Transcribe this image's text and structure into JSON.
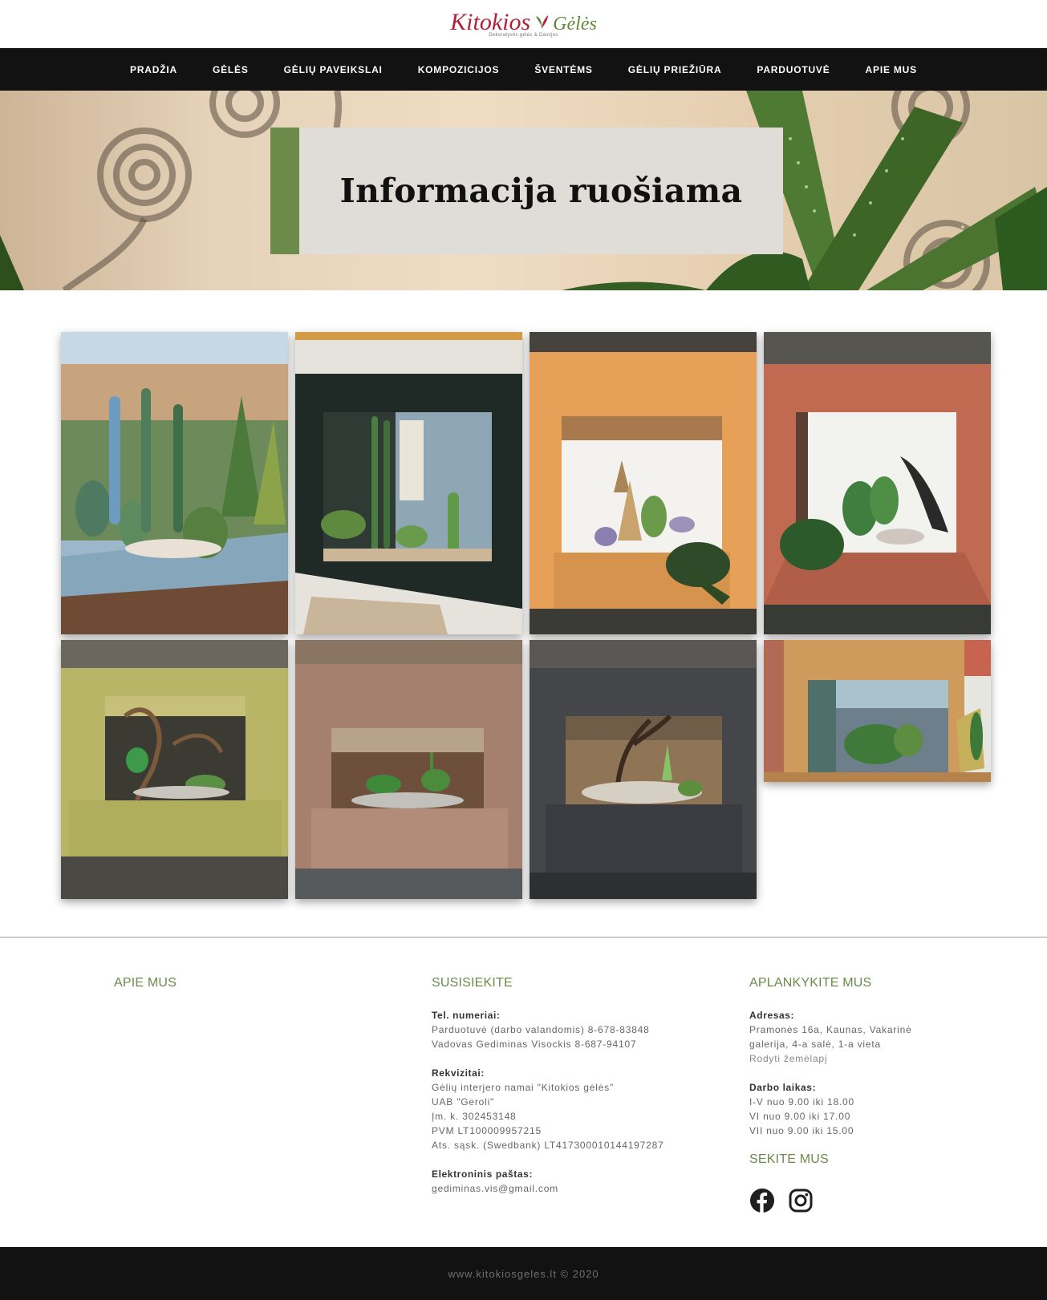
{
  "logo": {
    "word1": "Kitokios",
    "word2": "Gėlės",
    "tagline": "Dekoratyvės gėlės & Dainijos",
    "colors": {
      "primary": "#b3203a",
      "secondary": "#5f8a3a"
    }
  },
  "nav": {
    "items": [
      {
        "label": "PRADŽIA"
      },
      {
        "label": "GĖLĖS"
      },
      {
        "label": "GĖLIŲ PAVEIKSLAI"
      },
      {
        "label": "KOMPOZICIJOS"
      },
      {
        "label": "ŠVENTĖMS"
      },
      {
        "label": "GĖLIŲ PRIEŽIŪRA"
      },
      {
        "label": "PARDUOTUVĖ"
      },
      {
        "label": "APIE MUS"
      }
    ]
  },
  "hero": {
    "title": "Informacija ruošiama",
    "accent_color": "#6c8a4a"
  },
  "gallery": {
    "images": [
      {
        "name": "gallery-image-1",
        "description": "succulents-in-blue-box"
      },
      {
        "name": "gallery-image-2",
        "description": "dark-green-frame-with-cacti"
      },
      {
        "name": "gallery-image-3",
        "description": "orange-frame-with-succulents"
      },
      {
        "name": "gallery-image-4",
        "description": "red-frame-with-cacti"
      },
      {
        "name": "gallery-image-5",
        "description": "yellow-green-frame-with-driftwood"
      },
      {
        "name": "gallery-image-6",
        "description": "brown-frame-with-succulents"
      },
      {
        "name": "gallery-image-7",
        "description": "dark-frame-with-driftwood"
      },
      {
        "name": "gallery-image-8",
        "description": "light-wood-frame-with-plants"
      }
    ]
  },
  "footer": {
    "about": {
      "heading": "APIE MUS"
    },
    "contact": {
      "heading": "SUSISIEKITE",
      "phone_label": "Tel. numeriai:",
      "phone_lines": [
        "Parduotuvė (darbo valandomis) 8-678-83848",
        "Vadovas Gediminas Visockis 8-687-94107"
      ],
      "requisites_label": "Rekvizitai:",
      "requisites_lines": [
        "Gėlių interjero namai \"Kitokios gėlės\"",
        "UAB \"Geroli\"",
        "Įm. k. 302453148",
        "PVM LT100009957215",
        "Ats. sąsk. (Swedbank) LT417300010144197287"
      ],
      "email_label": "Elektroninis paštas:",
      "email": "gediminas.vis@gmail.com"
    },
    "visit": {
      "heading": "APLANKYKITE MUS",
      "address_label": "Adresas:",
      "address_lines": [
        "Pramonės 16a, Kaunas, Vakarinė",
        "galerija, 4-a salė, 1-a vieta"
      ],
      "map_link": "Rodyti žemėlapį",
      "hours_label": "Darbo laikas:",
      "hours_lines": [
        "I-V nuo 9.00 iki 18.00",
        "VI nuo 9.00 iki 17.00",
        "VII nuo 9.00 iki 15.00"
      ],
      "follow_heading": "SEKITE MUS",
      "social": [
        {
          "name": "facebook-icon"
        },
        {
          "name": "instagram-icon"
        }
      ]
    },
    "copyright": "www.kitokiosgeles.lt © 2020"
  }
}
